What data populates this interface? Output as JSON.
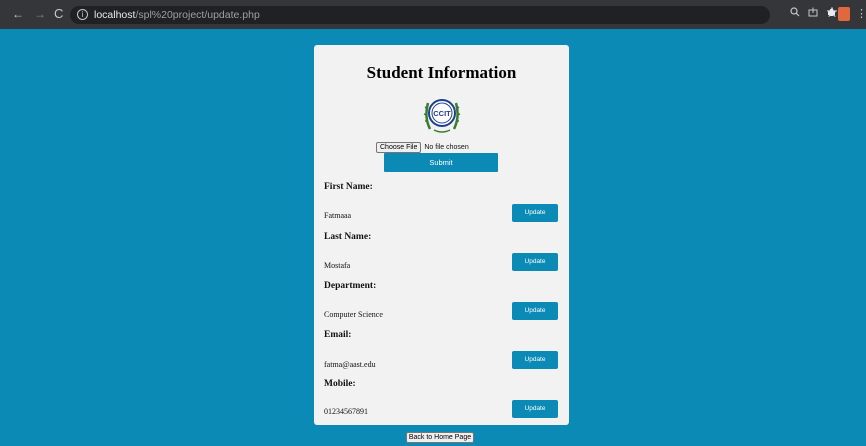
{
  "browser": {
    "back_glyph": "←",
    "forward_glyph": "→",
    "reload_glyph": "C",
    "info_glyph": "i",
    "url_host": "localhost",
    "url_path": "/spl%20project/update.php",
    "icons": [
      "zoom-icon",
      "share-icon",
      "star-icon",
      "extensions-icon",
      "profile-avatar",
      "menu-icon"
    ],
    "menu_glyph": "⋮"
  },
  "page": {
    "title": "Student Information",
    "file_input": {
      "button_label": "Choose File",
      "status": "No file chosen"
    },
    "submit_label": "Submit",
    "fields": [
      {
        "label": "First Name:",
        "value": "Fatmaaa",
        "button": "Update"
      },
      {
        "label": "Last Name:",
        "value": "Mostafa",
        "button": "Update"
      },
      {
        "label": "Department:",
        "value": "Computer Science",
        "button": "Update"
      },
      {
        "label": "Email:",
        "value": "fatma@aast.edu",
        "button": "Update"
      },
      {
        "label": "Mobile:",
        "value": "01234567891",
        "button": "Update"
      }
    ],
    "home_button": "Back to Home Page"
  },
  "colors": {
    "background": "#0a8ab5",
    "card": "#f2f2f2",
    "accent": "#0a8ab5"
  }
}
